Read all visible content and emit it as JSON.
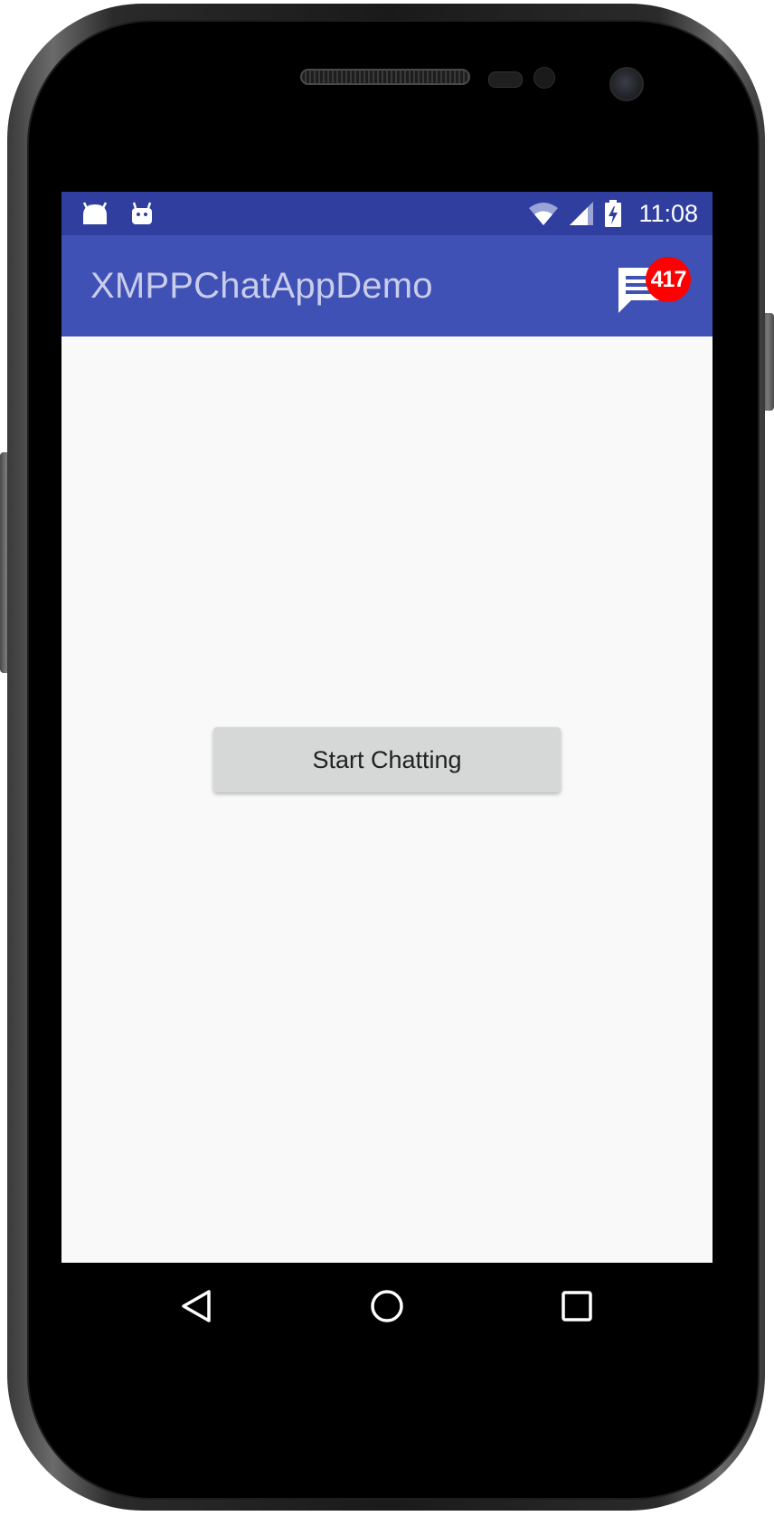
{
  "status_bar": {
    "time": "11:08",
    "left_icons": [
      "android-notification-icon",
      "android-debug-icon"
    ],
    "right_icons": [
      "wifi-icon",
      "cell-signal-icon",
      "battery-charging-icon"
    ],
    "background_color": "#303f9f"
  },
  "app_bar": {
    "title": "XMPPChatAppDemo",
    "background_color": "#3f51b5",
    "chat_action": {
      "icon": "chat-icon",
      "badge_count": "417",
      "badge_color": "#ff0000"
    }
  },
  "main": {
    "start_button_label": "Start Chatting"
  },
  "nav_bar": {
    "buttons": [
      "back-icon",
      "home-icon",
      "recents-icon"
    ]
  }
}
